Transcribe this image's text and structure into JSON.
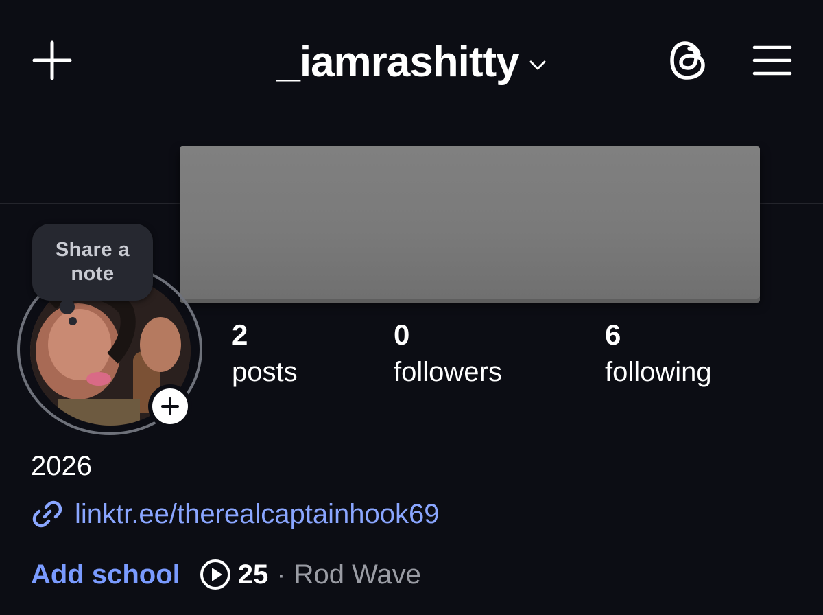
{
  "header": {
    "username": "_iamrashitty",
    "icons": {
      "new": "plus-icon",
      "dropdown": "chevron-down-icon",
      "threads": "threads-icon",
      "menu": "hamburger-menu-icon"
    }
  },
  "note": {
    "label": "Share a note"
  },
  "stats": {
    "posts": {
      "value": "2",
      "label": "posts"
    },
    "followers": {
      "value": "0",
      "label": "followers"
    },
    "following": {
      "value": "6",
      "label": "following"
    }
  },
  "bio": {
    "text": "2026",
    "link": "linktr.ee/therealcaptainhook69"
  },
  "actions": {
    "add_school": "Add school"
  },
  "music": {
    "count": "25",
    "separator": "·",
    "artist": "Rod Wave"
  },
  "colors": {
    "background": "#0c0d14",
    "link": "#8aa6ff",
    "accent": "#7a9bff",
    "secondary_text": "#9a9ca4",
    "redaction": "#7a7a7a"
  }
}
